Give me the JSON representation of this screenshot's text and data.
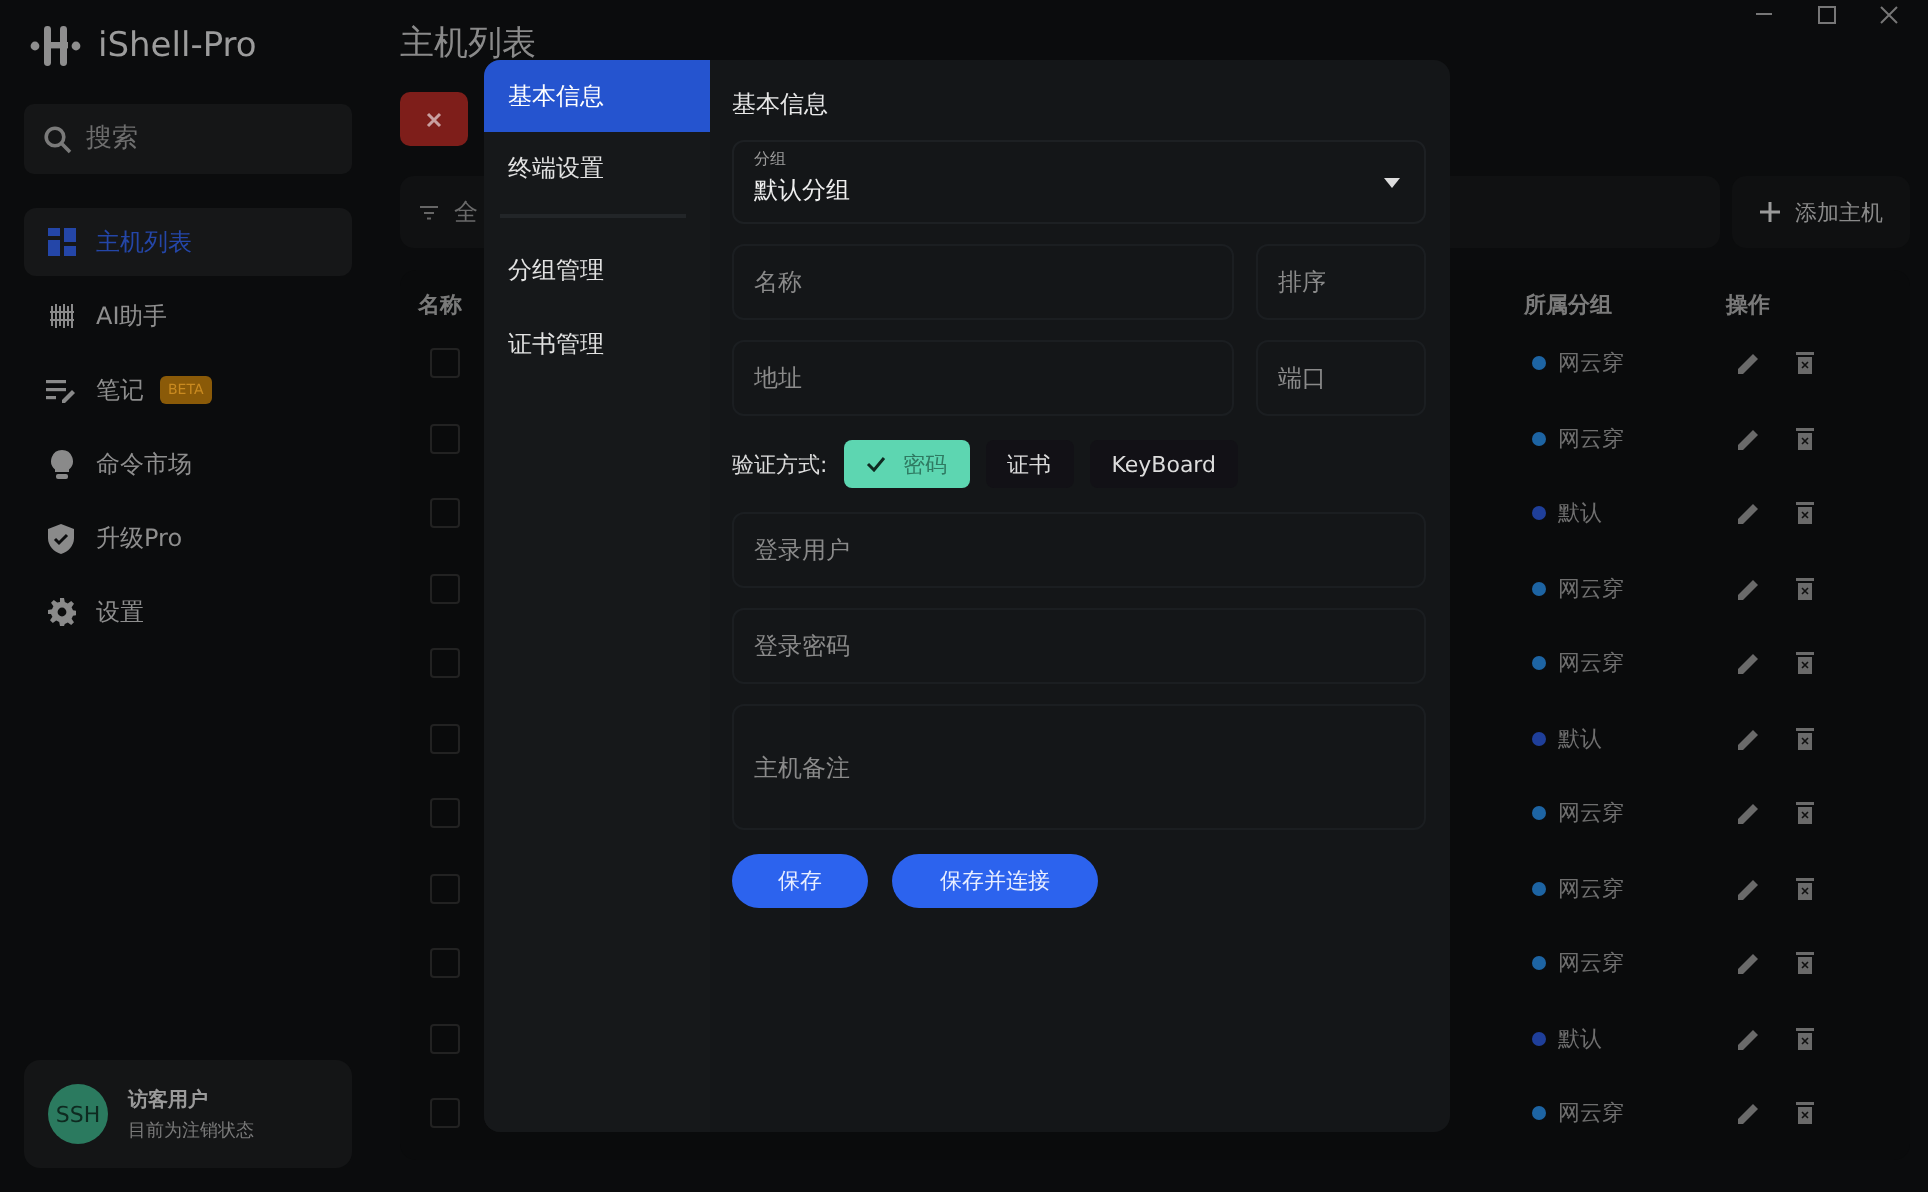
{
  "app": {
    "name": "iShell-Pro"
  },
  "sidebar": {
    "search": {
      "placeholder": "搜索"
    },
    "items": [
      {
        "kind": "grid",
        "label": "主机列表",
        "selected": true
      },
      {
        "kind": "ai",
        "label": "AI助手",
        "selected": false
      },
      {
        "kind": "notes",
        "label": "笔记",
        "badge": "BETA",
        "selected": false
      },
      {
        "kind": "bulb",
        "label": "命令市场",
        "selected": false
      },
      {
        "kind": "shield",
        "label": "升级Pro",
        "selected": false
      },
      {
        "kind": "gear",
        "label": "设置",
        "selected": false
      }
    ],
    "user": {
      "avatar": "SSH",
      "name": "访客用户",
      "status": "目前为注销状态"
    }
  },
  "page": {
    "title": "主机列表",
    "filter": "全",
    "add_button": "添加主机"
  },
  "table": {
    "columns": [
      "名称",
      "所属分组",
      "操作"
    ],
    "rows": [
      {
        "checked": false,
        "group": "网云穿",
        "color": "#1d64a3"
      },
      {
        "checked": false,
        "group": "网云穿",
        "color": "#1d64a3"
      },
      {
        "checked": false,
        "group": "默认",
        "color": "#1f3f9a"
      },
      {
        "checked": false,
        "group": "网云穿",
        "color": "#1d64a3"
      },
      {
        "checked": false,
        "group": "网云穿",
        "color": "#1d64a3"
      },
      {
        "checked": false,
        "group": "默认",
        "color": "#1f3f9a"
      },
      {
        "checked": false,
        "group": "网云穿",
        "color": "#1d64a3"
      },
      {
        "checked": false,
        "group": "网云穿",
        "color": "#1d64a3"
      },
      {
        "checked": false,
        "group": "网云穿",
        "color": "#1d64a3"
      },
      {
        "checked": false,
        "group": "默认",
        "color": "#1f3f9a"
      },
      {
        "checked": false,
        "group": "网云穿",
        "color": "#1d64a3"
      }
    ]
  },
  "dialog": {
    "nav": [
      {
        "label": "基本信息",
        "selected": true
      },
      {
        "label": "终端设置",
        "selected": false
      }
    ],
    "nav_more": [
      {
        "label": "分组管理"
      },
      {
        "label": "证书管理"
      }
    ],
    "section_title": "基本信息",
    "group_select": {
      "label": "分组",
      "value": "默认分组"
    },
    "field_rows": [
      [
        {
          "placeholder": "名称"
        },
        {
          "placeholder": "排序"
        }
      ],
      [
        {
          "placeholder": "地址"
        },
        {
          "placeholder": "端口"
        }
      ]
    ],
    "auth": {
      "label": "验证方式:",
      "options": [
        {
          "label": "密码",
          "selected": true
        },
        {
          "label": "证书",
          "selected": false
        },
        {
          "label": "KeyBoard",
          "selected": false
        }
      ]
    },
    "credential_fields": [
      {
        "placeholder": "登录用户"
      },
      {
        "placeholder": "登录密码"
      }
    ],
    "remark": {
      "placeholder": "主机备注"
    },
    "buttons": [
      "保存",
      "保存并连接"
    ]
  }
}
